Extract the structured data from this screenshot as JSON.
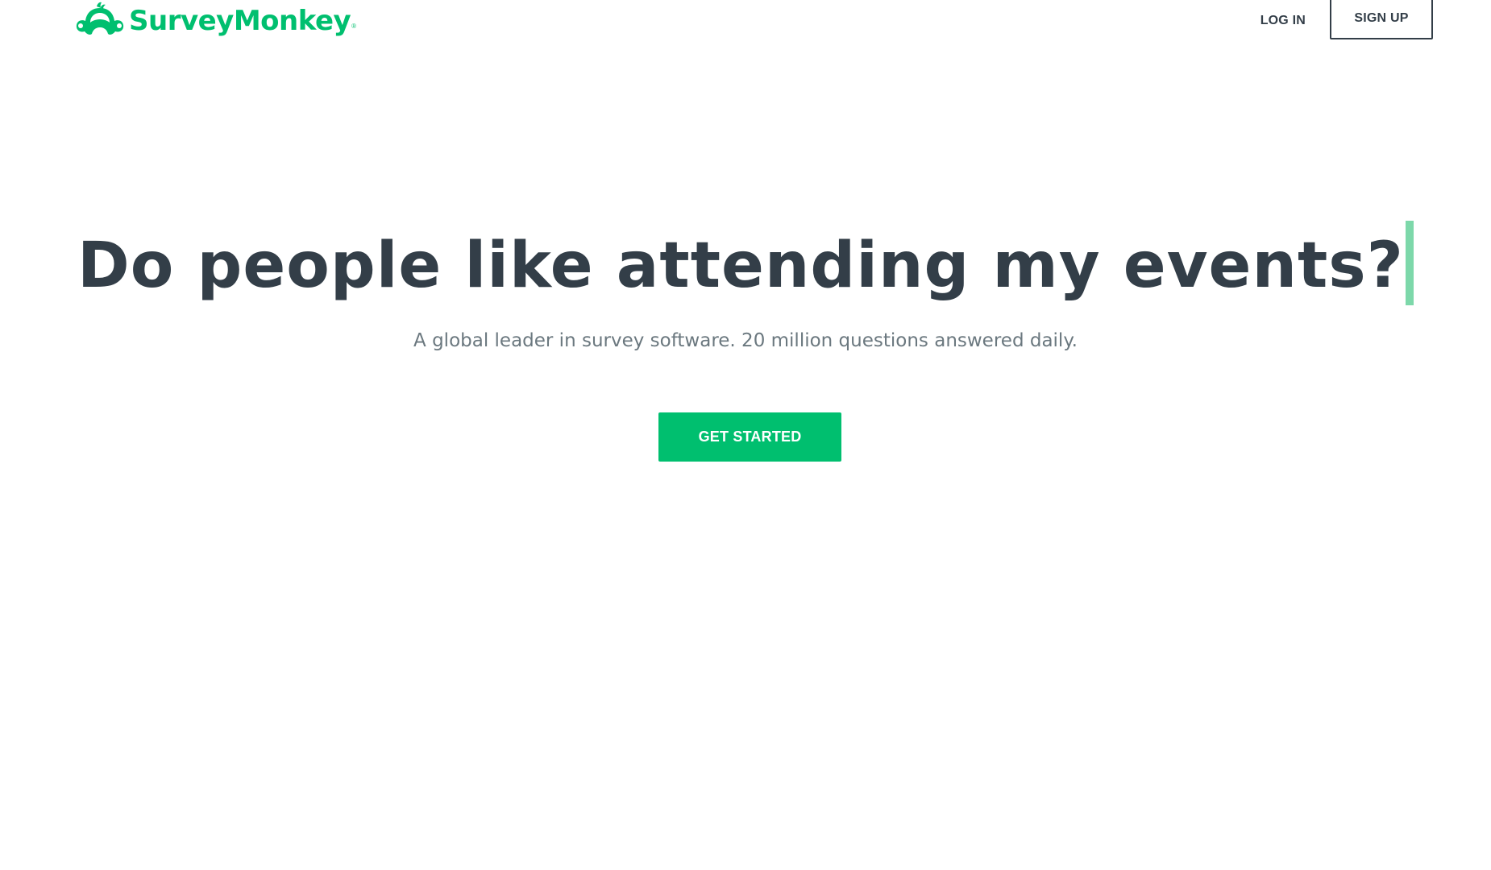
{
  "header": {
    "logo_text": "SurveyMonkey",
    "logo_registered": "®",
    "login_label": "LOG IN",
    "signup_label": "SIGN UP"
  },
  "hero": {
    "title": "Do people like attending my events?",
    "subtitle": "A global leader in survey software. 20 million questions answered daily.",
    "cta_label": "GET STARTED"
  },
  "colors": {
    "brand_green": "#00bf6f",
    "text_dark": "#333e48",
    "text_muted": "#6b787f",
    "cursor": "#7dd8aa"
  },
  "icons": {
    "logo": "surveymonkey-logo-icon"
  }
}
